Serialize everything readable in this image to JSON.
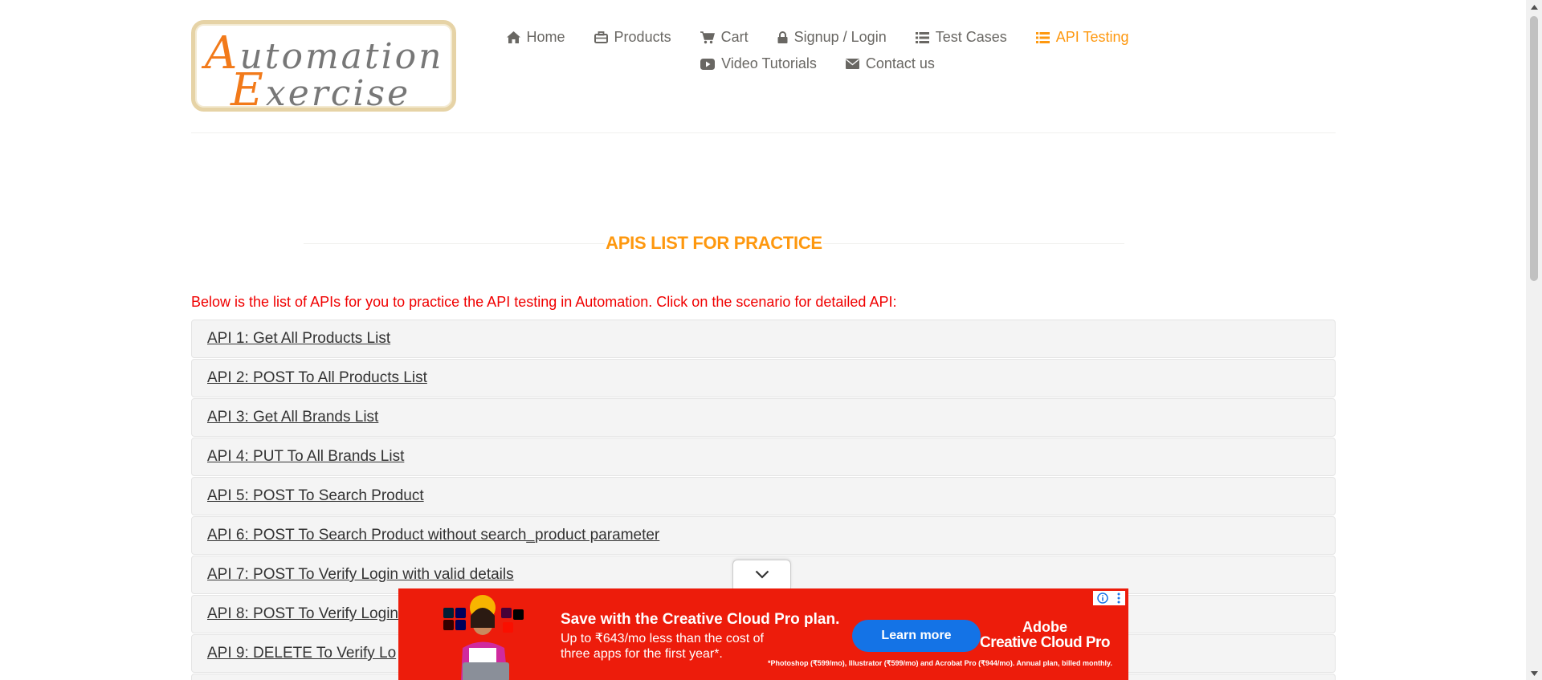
{
  "logo": {
    "line1_cap": "A",
    "line1_rest": "utomation",
    "line2_cap": "E",
    "line2_rest": "xercise",
    "accent": "#f27a1a"
  },
  "nav": {
    "items": [
      {
        "label": "Home",
        "icon": "home-icon"
      },
      {
        "label": "Products",
        "icon": "briefcase-icon"
      },
      {
        "label": "Cart",
        "icon": "cart-icon"
      },
      {
        "label": "Signup / Login",
        "icon": "lock-icon"
      },
      {
        "label": "Test Cases",
        "icon": "list-icon"
      },
      {
        "label": "API Testing",
        "icon": "list-icon",
        "active": true
      },
      {
        "label": "Video Tutorials",
        "icon": "youtube-play-icon"
      },
      {
        "label": "Contact us",
        "icon": "envelope-icon"
      }
    ],
    "active_color": "#FE980F"
  },
  "section": {
    "title": "APIS LIST FOR PRACTICE",
    "intro": "Below is the list of APIs for you to practice the API testing in Automation. Click on the scenario for detailed API:"
  },
  "apis": [
    "API 1: Get All Products List",
    "API 2: POST To All Products List",
    "API 3: Get All Brands List",
    "API 4: PUT To All Brands List",
    "API 5: POST To Search Product",
    "API 6: POST To Search Product without search_product parameter",
    "API 7: POST To Verify Login with valid details",
    "API 8: POST To Verify Login",
    "API 9: DELETE To Verify Lo"
  ],
  "ad": {
    "headline": "Save with the Creative Cloud Pro plan.",
    "subtext": "Up to ₹643/mo less than the cost of three apps for the first year*.",
    "button": "Learn more",
    "brand_line1": "Adobe",
    "brand_line2": "Creative Cloud Pro",
    "fine_print": "*Photoshop (₹599/mo), Illustrator (₹599/mo) and Acrobat Pro (₹944/mo). Annual plan, billed monthly.",
    "background": "#ed1c0b"
  }
}
